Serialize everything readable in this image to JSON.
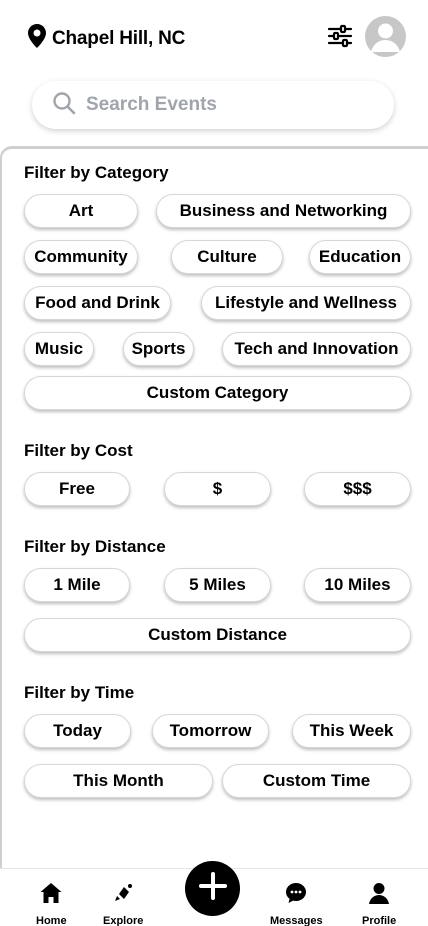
{
  "header": {
    "location": "Chapel Hill, NC",
    "location_icon": "map-pin-icon",
    "filter_icon": "sliders-icon",
    "avatar_icon": "user-avatar-icon"
  },
  "search": {
    "placeholder": "Search Events",
    "icon": "search-icon"
  },
  "filters": {
    "category": {
      "title": "Filter by Category",
      "options": [
        "Art",
        "Business and Networking",
        "Community",
        "Culture",
        "Education",
        "Food and Drink",
        "Lifestyle and Wellness",
        "Music",
        "Sports",
        "Tech and Innovation",
        "Custom Category"
      ]
    },
    "cost": {
      "title": "Filter by Cost",
      "options": [
        "Free",
        "$",
        "$$$"
      ]
    },
    "distance": {
      "title": "Filter by Distance",
      "options": [
        "1 Mile",
        "5 Miles",
        "10 Miles",
        "Custom Distance"
      ]
    },
    "time": {
      "title": "Filter by Time",
      "options": [
        "Today",
        "Tomorrow",
        "This Week",
        "This Month",
        "Custom Time"
      ]
    }
  },
  "tabbar": {
    "items": [
      {
        "label": "Home",
        "icon": "home-icon"
      },
      {
        "label": "Explore",
        "icon": "explore-icon"
      },
      {
        "label": "Messages",
        "icon": "messages-icon"
      },
      {
        "label": "Profile",
        "icon": "profile-icon"
      }
    ],
    "fab_icon": "plus-icon"
  },
  "colors": {
    "accent": "#000000",
    "placeholder": "#a0a4ab",
    "avatar_bg": "#c7c7c7",
    "border": "#cfcfcf"
  }
}
